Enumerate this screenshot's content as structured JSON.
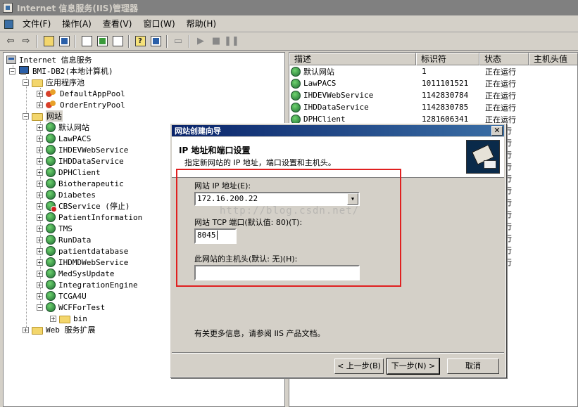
{
  "window": {
    "title": "Internet 信息服务(IIS)管理器"
  },
  "menu": [
    "文件(F)",
    "操作(A)",
    "查看(V)",
    "窗口(W)",
    "帮助(H)"
  ],
  "tree": {
    "root": "Internet 信息服务",
    "server": "BMI-DB2(本地计算机)",
    "app_pools": "应用程序池",
    "pools": [
      "DefaultAppPool",
      "OrderEntryPool"
    ],
    "websites": "网站",
    "sites": [
      "默认网站",
      "LawPACS",
      "IHDEVWebService",
      "IHDDataService",
      "DPHClient",
      "Biotherapeutic",
      "Diabetes",
      "CBService (停止)",
      "PatientInformation",
      "TMS",
      "RunData",
      "patientdatabase",
      "IHDMDWebService",
      "MedSysUpdate",
      "IntegrationEngine",
      "TCGA4U",
      "WCFForTest"
    ],
    "bin": "bin",
    "web_ext": "Web 服务扩展"
  },
  "list": {
    "headers": [
      "描述",
      "标识符",
      "状态",
      "主机头值"
    ],
    "rows": [
      {
        "name": "默认网站",
        "id": "1",
        "status": "正在运行"
      },
      {
        "name": "LawPACS",
        "id": "1011101521",
        "status": "正在运行"
      },
      {
        "name": "IHDEVWebService",
        "id": "1142830784",
        "status": "正在运行"
      },
      {
        "name": "IHDDataService",
        "id": "1142830785",
        "status": "正在运行"
      },
      {
        "name": "DPHClient",
        "id": "1281606341",
        "status": "正在运行"
      }
    ],
    "partial_status": "行"
  },
  "dialog": {
    "title": "网站创建向导",
    "header_title": "IP 地址和端口设置",
    "header_sub": "指定新网站的 IP 地址，端口设置和主机头。",
    "ip_label": "网站 IP 地址(E):",
    "ip_value": "172.16.200.22",
    "port_label": "网站 TCP 端口(默认值: 80)(T):",
    "port_value": "8045",
    "host_label": "此网站的主机头(默认: 无)(H):",
    "host_value": "",
    "info": "有关更多信息，请参阅 IIS 产品文档。",
    "watermark": "http://blog.csdn.net/",
    "back": "< 上一步(B)",
    "next": "下一步(N) >",
    "cancel": "取消"
  }
}
